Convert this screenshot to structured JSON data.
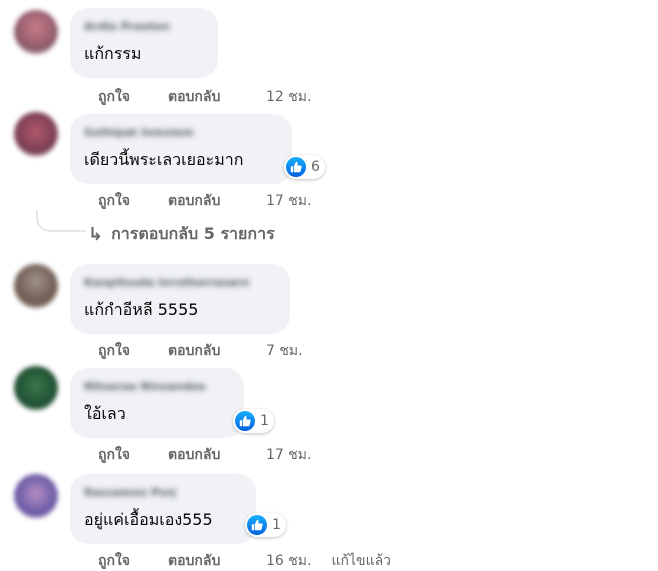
{
  "labels": {
    "like": "ถูกใจ",
    "reply": "ตอบกลับ"
  },
  "comments": [
    {
      "author": "Ardie Preeten",
      "text": "แก้กรรม",
      "time": "12 ชม.",
      "reactions": null,
      "edited": null
    },
    {
      "author": "Suthipat Inmsiem",
      "text": "เดียวนี้พระเลวเยอะมาก",
      "time": "17 ชม.",
      "reactions": "6",
      "edited": null
    },
    {
      "author": "Kanpitsuda Inrutherrasarn",
      "text": "แก้กำอีหลี 5555",
      "time": "7 ชม.",
      "reactions": null,
      "edited": null
    },
    {
      "author": "Nitsaraa Ninsandee",
      "text": "ใอ้เลว",
      "time": "17 ชม.",
      "reactions": "1",
      "edited": null
    },
    {
      "author": "Rassamon Porj",
      "text": "อยู่แค่เอื้อมเอง555",
      "time": "16 ชม.",
      "reactions": "1",
      "edited": "แก้ไขแล้ว"
    }
  ],
  "view_replies": "การตอบกลับ 5 รายการ",
  "colors": {
    "bubble": "#f0f2f5",
    "secondary_text": "#65676b",
    "like_blue": "#1877f2"
  },
  "icons": {
    "like": "thumbs-up-icon",
    "reply_arrow": "reply-arrow-icon"
  }
}
